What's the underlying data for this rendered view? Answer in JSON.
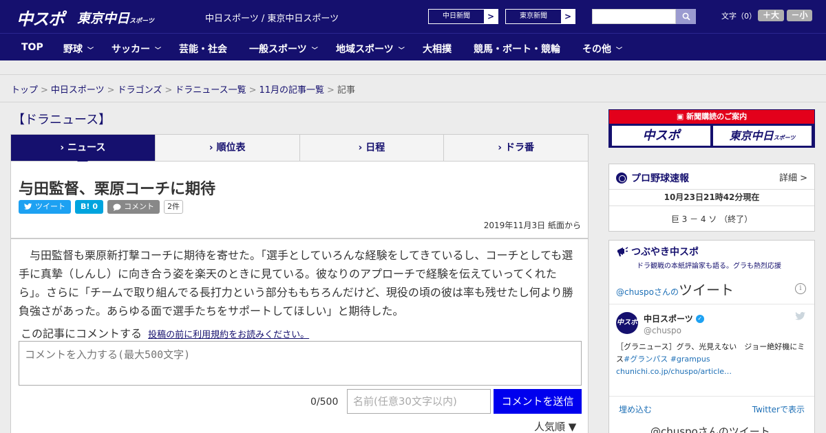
{
  "header": {
    "logo_main": "中スポ",
    "logo_sub": "東京中日",
    "logo_sub_small": "スポーツ",
    "site_title": "中日スポーツ / 東京中日スポーツ",
    "ext_links": [
      {
        "label": "中日新聞",
        "arrow": ">"
      },
      {
        "label": "東京新聞",
        "arrow": ">"
      }
    ],
    "search_placeholder": "",
    "font_size_label": "文字（0）",
    "font_larger": "＋大",
    "font_smaller": "－小",
    "brand_color": "#15106e"
  },
  "nav": {
    "items": [
      {
        "label": "TOP",
        "has_dropdown": false
      },
      {
        "label": "野球",
        "has_dropdown": true
      },
      {
        "label": "サッカー",
        "has_dropdown": true
      },
      {
        "label": "芸能・社会",
        "has_dropdown": false
      },
      {
        "label": "一般スポーツ",
        "has_dropdown": true
      },
      {
        "label": "地域スポーツ",
        "has_dropdown": true
      },
      {
        "label": "大相撲",
        "has_dropdown": false
      },
      {
        "label": "競馬・ボート・競輪",
        "has_dropdown": false
      },
      {
        "label": "その他",
        "has_dropdown": true
      }
    ],
    "chevron": "﹀"
  },
  "breadcrumb": {
    "links": [
      "トップ",
      "中日スポーツ",
      "ドラゴンズ",
      "ドラニュース一覧",
      "11月の記事一覧"
    ],
    "current": "記事",
    "separator": ">"
  },
  "section": {
    "title": "【ドラニュース】",
    "tabs": [
      {
        "label": "ニュース",
        "active": true
      },
      {
        "label": "順位表",
        "active": false
      },
      {
        "label": "日程",
        "active": false
      },
      {
        "label": "ドラ番",
        "active": false
      }
    ]
  },
  "article": {
    "headline": "与田監督、栗原コーチに期待",
    "tweet_label": "ツイート",
    "hatena_label": "B!",
    "hatena_count": "0",
    "comment_label": "コメント",
    "comment_count": "2件",
    "date": "2019年11月3日 紙面から",
    "body": "　与田監督も栗原新打撃コーチに期待を寄せた。「選手としていろんな経験をしてきているし、コーチとしても選手に真摯（しんし）に向き合う姿を楽天のときに見ている。彼なりのアプローチで経験を伝えていってくれたら」。さらに「チームで取り組んでる長打力という部分ももちろんだけど、現役の頃の彼は率も残せたし何より勝負強さがあった。あらゆる面で選手たちをサポートしてほしい」と期待した。"
  },
  "comments": {
    "heading": "この記事にコメントする",
    "rules_link": "投稿の前に利用規約をお読みください。",
    "input_placeholder": "コメントを入力する(最大500文字)",
    "char_count": "0/500",
    "name_placeholder": "名前(任意30文字以内)",
    "submit_label": "コメントを送信",
    "sort_label": "人気順 ▼",
    "submit_color": "#0000ee"
  },
  "sidebar": {
    "promo": {
      "title": "新聞購読のご案内",
      "logo_left": "中スポ",
      "logo_right": "東京中日",
      "logo_right_small": "スポーツ",
      "accent_color": "#e3001b"
    },
    "baseball": {
      "title": "プロ野球速報",
      "detail": "詳細 >",
      "as_of": "10月23日21時42分現在",
      "score": "巨 3 － 4 ソ （終了）"
    },
    "twitter": {
      "title": "つぶやき中スポ",
      "subtitle": "ドラ観戦の本紙評論家も語る。グラも熱烈応援",
      "widget_handle": "@chuspoさんの",
      "widget_title": "ツイート",
      "account_name": "中日スポーツ",
      "account_handle": "@chuspo",
      "avatar_text": "中スポ",
      "tweet_text": "［グラニュース］グラ、光見えない　ジョー絶好機にミス",
      "tweet_tags": "#グランパス #grampus",
      "tweet_link": "chunichi.co.jp/chuspo/article…",
      "embed_label": "埋め込む",
      "view_label": "Twitterで表示",
      "footer": "@chuspoさんのツイート"
    }
  }
}
